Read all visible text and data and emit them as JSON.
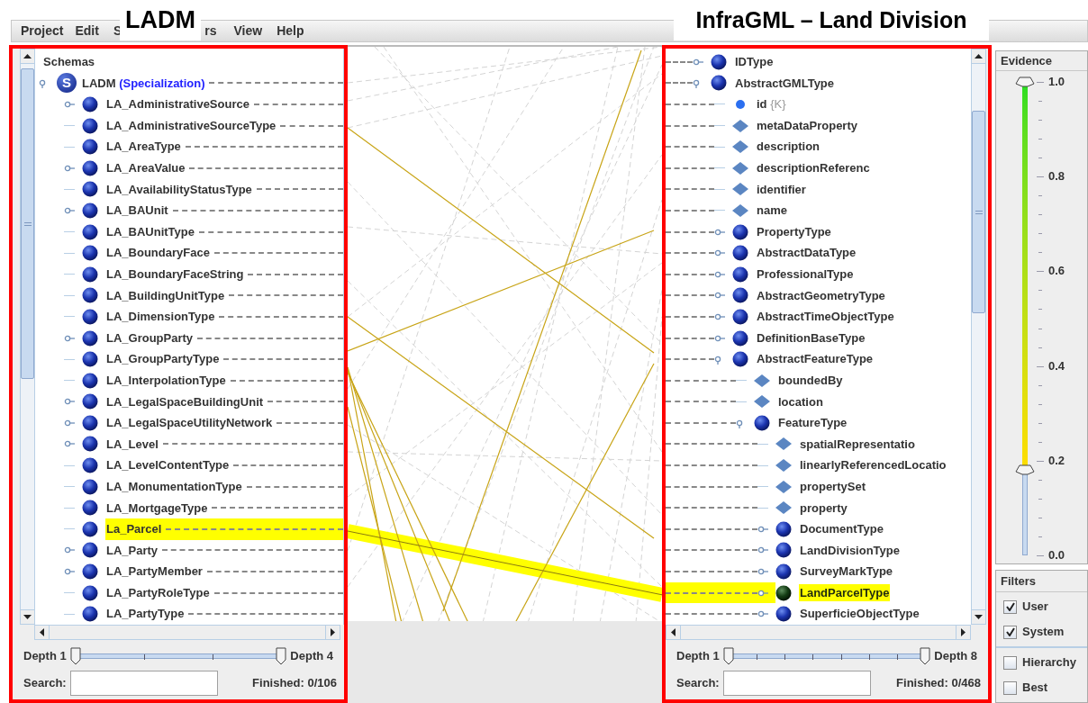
{
  "annotations": {
    "left_label": "LADM",
    "right_label": "InfraGML – Land Division"
  },
  "menu": [
    "Project",
    "Edit",
    "S",
    "rs",
    "View",
    "Help"
  ],
  "left_panel": {
    "tree": {
      "title": "Schemas",
      "root": {
        "badge": "S",
        "name": "LADM",
        "tag": "(Specialization)",
        "expandable": true,
        "selected": false,
        "highlighted": false,
        "children": [
          {
            "name": "LA_AdministrativeSource",
            "kind": "circle",
            "expandable": true,
            "selected": false,
            "highlighted": false
          },
          {
            "name": "LA_AdministrativeSourceType",
            "kind": "circle",
            "expandable": false,
            "selected": false,
            "highlighted": false
          },
          {
            "name": "LA_AreaType",
            "kind": "circle",
            "expandable": false,
            "selected": false,
            "highlighted": false
          },
          {
            "name": "LA_AreaValue",
            "kind": "circle",
            "expandable": true,
            "selected": false,
            "highlighted": false
          },
          {
            "name": "LA_AvailabilityStatusType",
            "kind": "circle",
            "expandable": false,
            "selected": false,
            "highlighted": false
          },
          {
            "name": "LA_BAUnit",
            "kind": "circle",
            "expandable": true,
            "selected": false,
            "highlighted": false
          },
          {
            "name": "LA_BAUnitType",
            "kind": "circle",
            "expandable": false,
            "selected": false,
            "highlighted": false
          },
          {
            "name": "LA_BoundaryFace",
            "kind": "circle",
            "expandable": false,
            "selected": false,
            "highlighted": false
          },
          {
            "name": "LA_BoundaryFaceString",
            "kind": "circle",
            "expandable": false,
            "selected": false,
            "highlighted": false
          },
          {
            "name": "LA_BuildingUnitType",
            "kind": "circle",
            "expandable": false,
            "selected": false,
            "highlighted": false
          },
          {
            "name": "LA_DimensionType",
            "kind": "circle",
            "expandable": false,
            "selected": false,
            "highlighted": false
          },
          {
            "name": "LA_GroupParty",
            "kind": "circle",
            "expandable": true,
            "selected": false,
            "highlighted": false
          },
          {
            "name": "LA_GroupPartyType",
            "kind": "circle",
            "expandable": false,
            "selected": false,
            "highlighted": false
          },
          {
            "name": "LA_InterpolationType",
            "kind": "circle",
            "expandable": false,
            "selected": false,
            "highlighted": false
          },
          {
            "name": "LA_LegalSpaceBuildingUnit",
            "kind": "circle",
            "expandable": true,
            "selected": false,
            "highlighted": false
          },
          {
            "name": "LA_LegalSpaceUtilityNetwork",
            "kind": "circle",
            "expandable": true,
            "selected": false,
            "highlighted": false
          },
          {
            "name": "LA_Level",
            "kind": "circle",
            "expandable": true,
            "selected": false,
            "highlighted": false
          },
          {
            "name": "LA_LevelContentType",
            "kind": "circle",
            "expandable": false,
            "selected": false,
            "highlighted": false
          },
          {
            "name": "LA_MonumentationType",
            "kind": "circle",
            "expandable": false,
            "selected": false,
            "highlighted": false
          },
          {
            "name": "LA_MortgageType",
            "kind": "circle",
            "expandable": false,
            "selected": false,
            "highlighted": false
          },
          {
            "name": "La_Parcel",
            "kind": "circle",
            "expandable": false,
            "selected": false,
            "highlighted": true
          },
          {
            "name": "LA_Party",
            "kind": "circle",
            "expandable": true,
            "selected": false,
            "highlighted": false
          },
          {
            "name": "LA_PartyMember",
            "kind": "circle",
            "expandable": true,
            "selected": false,
            "highlighted": false
          },
          {
            "name": "LA_PartyRoleType",
            "kind": "circle",
            "expandable": false,
            "selected": false,
            "highlighted": false
          },
          {
            "name": "LA_PartyType",
            "kind": "circle",
            "expandable": false,
            "selected": false,
            "highlighted": false
          }
        ]
      }
    },
    "depth": {
      "min_label": "Depth 1",
      "max_label": "Depth 4",
      "thumbs": [
        {
          "level": 0
        },
        {
          "level": 1
        }
      ]
    },
    "search": {
      "label": "Search:"
    },
    "status": "Finished: 0/106"
  },
  "right_panel": {
    "tree": [
      {
        "name": "IDType",
        "kind": "circle",
        "expandable": true,
        "selected": false,
        "highlighted": false
      },
      {
        "name": "AbstractGMLType",
        "kind": "circle",
        "expandable": true,
        "selected": false,
        "highlighted": false,
        "children": [
          {
            "name": "id",
            "key": "{K}",
            "kind": "dot",
            "expandable": false,
            "selected": false,
            "highlighted": false
          },
          {
            "name": "metaDataProperty",
            "kind": "diamond",
            "expandable": false,
            "selected": false,
            "highlighted": false
          },
          {
            "name": "description",
            "kind": "diamond",
            "expandable": false,
            "selected": false,
            "highlighted": false
          },
          {
            "name": "descriptionReferenc",
            "kind": "diamond",
            "expandable": false,
            "selected": false,
            "highlighted": false
          },
          {
            "name": "identifier",
            "kind": "diamond",
            "expandable": false,
            "selected": false,
            "highlighted": false
          },
          {
            "name": "name",
            "kind": "diamond",
            "expandable": false,
            "selected": false,
            "highlighted": false
          },
          {
            "name": "PropertyType",
            "kind": "circle",
            "expandable": true,
            "selected": false,
            "highlighted": false
          },
          {
            "name": "AbstractDataType",
            "kind": "circle",
            "expandable": true,
            "selected": false,
            "highlighted": false
          },
          {
            "name": "ProfessionalType",
            "kind": "circle",
            "expandable": true,
            "selected": false,
            "highlighted": false
          },
          {
            "name": "AbstractGeometryType",
            "kind": "circle",
            "expandable": true,
            "selected": false,
            "highlighted": false
          },
          {
            "name": "AbstractTimeObjectType",
            "kind": "circle",
            "expandable": true,
            "selected": false,
            "highlighted": false
          },
          {
            "name": "DefinitionBaseType",
            "kind": "circle",
            "expandable": true,
            "selected": false,
            "highlighted": false
          },
          {
            "name": "AbstractFeatureType",
            "kind": "circle",
            "expandable": true,
            "selected": false,
            "highlighted": false,
            "children": [
              {
                "name": "boundedBy",
                "kind": "diamond",
                "expandable": false,
                "selected": false,
                "highlighted": false
              },
              {
                "name": "location",
                "kind": "diamond",
                "expandable": false,
                "selected": false,
                "highlighted": false
              },
              {
                "name": "FeatureType",
                "kind": "circle",
                "expandable": true,
                "selected": false,
                "highlighted": false,
                "children": [
                  {
                    "name": "spatialRepresentatio",
                    "kind": "diamond",
                    "expandable": false,
                    "selected": false,
                    "highlighted": false
                  },
                  {
                    "name": "linearlyReferencedLocatio",
                    "kind": "diamond",
                    "expandable": false,
                    "selected": false,
                    "highlighted": false
                  },
                  {
                    "name": "propertySet",
                    "kind": "diamond",
                    "expandable": false,
                    "selected": false,
                    "highlighted": false
                  },
                  {
                    "name": "property",
                    "kind": "diamond",
                    "expandable": false,
                    "selected": false,
                    "highlighted": false
                  },
                  {
                    "name": "DocumentType",
                    "kind": "circle",
                    "expandable": true,
                    "selected": false,
                    "highlighted": false
                  },
                  {
                    "name": "LandDivisionType",
                    "kind": "circle",
                    "expandable": true,
                    "selected": false,
                    "highlighted": false
                  },
                  {
                    "name": "SurveyMarkType",
                    "kind": "circle",
                    "expandable": true,
                    "selected": false,
                    "highlighted": false
                  },
                  {
                    "name": "LandParcelType",
                    "kind": "circle",
                    "expandable": true,
                    "selected": true,
                    "highlighted": true
                  },
                  {
                    "name": "SuperficieObjectType",
                    "kind": "circle",
                    "expandable": true,
                    "selected": false,
                    "highlighted": false
                  }
                ]
              }
            ]
          }
        ]
      }
    ],
    "depth": {
      "min_label": "Depth 1",
      "max_label": "Depth 8",
      "thumbs": [
        {
          "level": 0
        },
        {
          "level": 1
        }
      ]
    },
    "search": {
      "label": "Search:"
    },
    "status": "Finished: 0/468"
  },
  "evidence": {
    "title": "Evidence",
    "scale": [
      "1.0",
      "0.8",
      "0.6",
      "0.4",
      "0.2",
      "0.0"
    ],
    "thumbs": [
      {
        "level": 1
      },
      {
        "level": 0.18
      }
    ]
  },
  "filters": {
    "title": "Filters",
    "groups": [
      [
        {
          "label": "User",
          "checked": true
        },
        {
          "label": "System",
          "checked": true
        }
      ],
      [
        {
          "label": "Hierarchy",
          "checked": false
        },
        {
          "label": "Best",
          "checked": false
        }
      ]
    ]
  }
}
